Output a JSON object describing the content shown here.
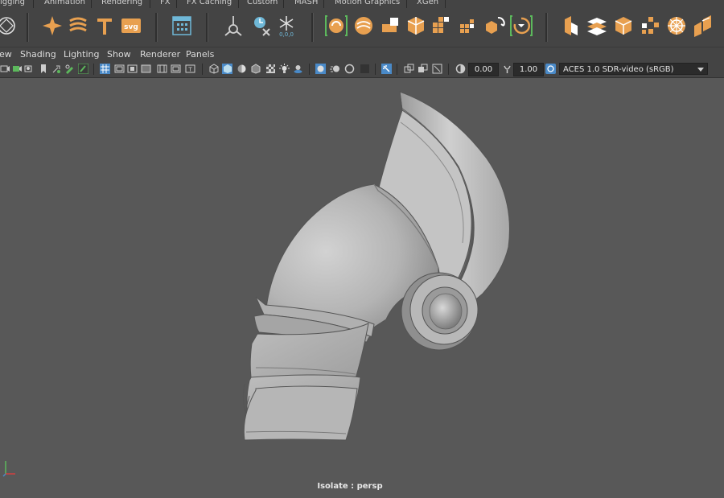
{
  "shelf_tabs": [
    "igging",
    "Animation",
    "Rendering",
    "FX",
    "FX Caching",
    "Custom",
    "MASH",
    "Motion Graphics",
    "XGen"
  ],
  "shelf_icons": [
    "polygon-sphere-icon",
    "create-nurbs-spark-icon",
    "sweep-mesh-icon",
    "text-tool-icon",
    "svg-tool-icon",
    "uv-editor-icon",
    "pivot-point-icon",
    "timeline-clear-icon",
    "snowflake-reset-icon",
    "orange-sphere-bracket-icon",
    "orange-sphere-icon",
    "orange-cubes-icon",
    "orange-cube-split-icon",
    "orange-grid-icon",
    "orange-grid-small-icon",
    "orange-cube-cycle-icon",
    "orange-cycle-bracket-icon",
    "orange-cube-stack-icon",
    "orange-layers-icon",
    "orange-cube-icon",
    "orange-scatter-icon",
    "orange-wheel-icon",
    "orange-sliced-cube-icon"
  ],
  "menu": [
    "ew",
    "Shading",
    "Lighting",
    "Show",
    "Renderer",
    "Panels"
  ],
  "toolbar": {
    "exposure": "0.00",
    "gamma": "1.00",
    "color_space": "ACES 1.0 SDR-video (sRGB)"
  },
  "viewport": {
    "isolate_label": "Isolate : persp"
  },
  "colors": {
    "ui_bg": "#444444",
    "viewport_bg": "#585858",
    "accent_orange": "#e8a050",
    "accent_green": "#5cb85c",
    "highlight_blue": "#4a8ac8"
  }
}
